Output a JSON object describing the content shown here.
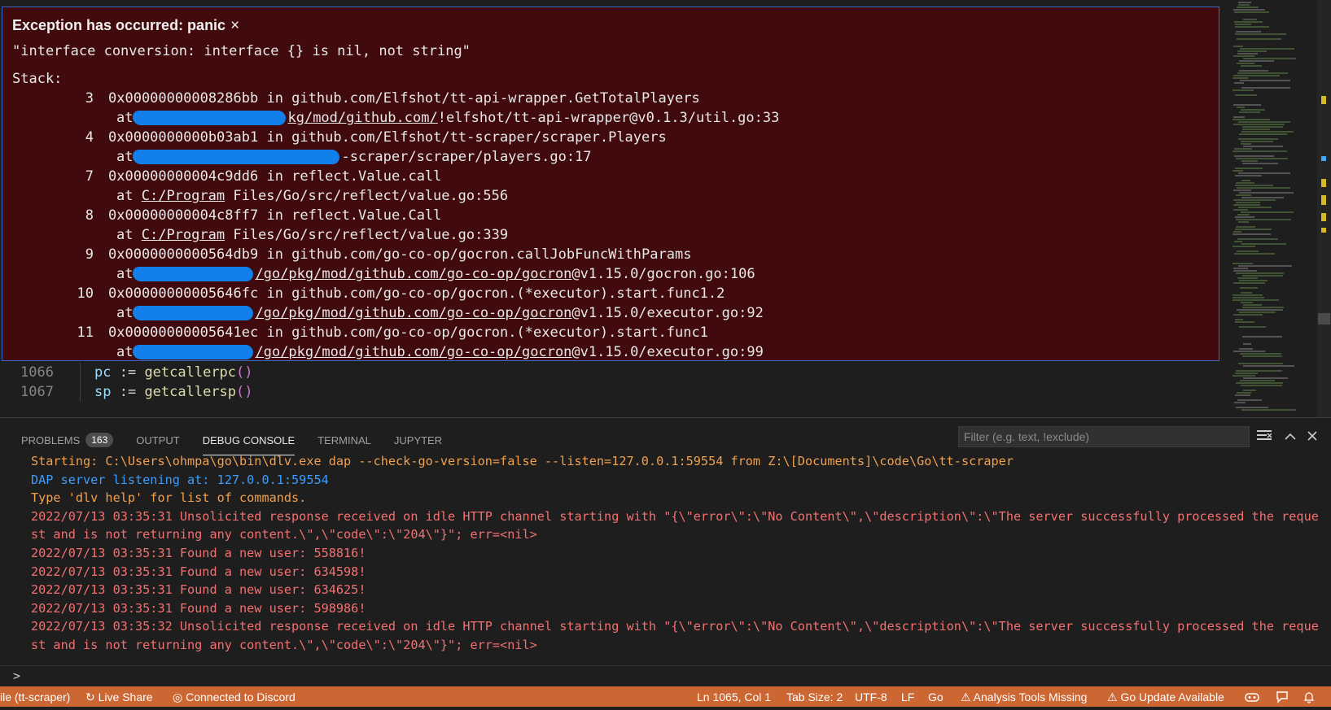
{
  "exception": {
    "title": "Exception has occurred: panic",
    "close_glyph": "×",
    "message": "\"interface conversion: interface {} is nil, not string\"",
    "stack_label": "Stack:",
    "frames": [
      {
        "num": "3",
        "addr": "0x00000000008286bb in github.com/Elfshot/tt-api-wrapper.GetTotalPlayers",
        "at": "at",
        "path_tail_link": "kg/mod/github.com/",
        "path_rest": "!elfshot/tt-api-wrapper@v0.1.3/util.go:33"
      },
      {
        "num": "4",
        "addr": "0x0000000000b03ab1 in github.com/Elfshot/tt-scraper/scraper.Players",
        "at": "at",
        "path_rest": "-scraper/scraper/players.go:17"
      },
      {
        "num": "7",
        "addr": "0x00000000004c9dd6 in reflect.Value.call",
        "at": "at",
        "path_link": "C:/Program",
        "path_rest": " Files/Go/src/reflect/value.go:556"
      },
      {
        "num": "8",
        "addr": "0x00000000004c8ff7 in reflect.Value.Call",
        "at": "at",
        "path_link": "C:/Program",
        "path_rest": " Files/Go/src/reflect/value.go:339"
      },
      {
        "num": "9",
        "addr": "0x0000000000564db9 in github.com/go-co-op/gocron.callJobFuncWithParams",
        "at": "at",
        "path_link": "/go/pkg/mod/github.com/go-co-op/gocron",
        "path_rest": "@v1.15.0/gocron.go:106"
      },
      {
        "num": "10",
        "addr": "0x00000000005646fc in github.com/go-co-op/gocron.(*executor).start.func1.2",
        "at": "at",
        "path_link": "/go/pkg/mod/github.com/go-co-op/gocron",
        "path_rest": "@v1.15.0/executor.go:92"
      },
      {
        "num": "11",
        "addr": "0x00000000005641ec in github.com/go-co-op/gocron.(*executor).start.func1",
        "at": "at",
        "path_link": "/go/pkg/mod/github.com/go-co-op/gocron",
        "path_rest": "@v1.15.0/executor.go:99"
      }
    ]
  },
  "code": {
    "lines": [
      {
        "num": "1066",
        "var": "pc",
        "op": " := ",
        "fn": "getcallerpc",
        "paren": "()"
      },
      {
        "num": "1067",
        "var": "sp",
        "op": " := ",
        "fn": "getcallersp",
        "paren": "()"
      }
    ]
  },
  "panel": {
    "tabs": [
      {
        "label": "PROBLEMS",
        "badge": "163"
      },
      {
        "label": "OUTPUT"
      },
      {
        "label": "DEBUG CONSOLE",
        "active": true
      },
      {
        "label": "TERMINAL"
      },
      {
        "label": "JUPYTER"
      }
    ],
    "filter_placeholder": "Filter (e.g. text, !exclude)",
    "console_lines": [
      {
        "color": "orange",
        "text": "Starting: C:\\Users\\ohmpa\\go\\bin\\dlv.exe dap --check-go-version=false --listen=127.0.0.1:59554 from Z:\\[Documents]\\code\\Go\\tt-scraper"
      },
      {
        "color": "blue",
        "text": "DAP server listening at: 127.0.0.1:59554"
      },
      {
        "color": "orange",
        "text": "Type 'dlv help' for list of commands."
      },
      {
        "color": "red",
        "text": "2022/07/13 03:35:31 Unsolicited response received on idle HTTP channel starting with \"{\\\"error\\\":\\\"No Content\\\",\\\"description\\\":\\\"The server successfully processed the request and is not returning any content.\\\",\\\"code\\\":\\\"204\\\"}\"; err=<nil>"
      },
      {
        "color": "red",
        "text": "2022/07/13 03:35:31 Found a new user: 558816!"
      },
      {
        "color": "red",
        "text": "2022/07/13 03:35:31 Found a new user: 634598!"
      },
      {
        "color": "red",
        "text": "2022/07/13 03:35:31 Found a new user: 634625!"
      },
      {
        "color": "red",
        "text": "2022/07/13 03:35:31 Found a new user: 598986!"
      },
      {
        "color": "red",
        "text": "2022/07/13 03:35:32 Unsolicited response received on idle HTTP channel starting with \"{\\\"error\\\":\\\"No Content\\\",\\\"description\\\":\\\"The server successfully processed the request and is not returning any content.\\\",\\\"code\\\":\\\"204\\\"}\"; err=<nil>"
      }
    ],
    "prompt": ">"
  },
  "statusbar": {
    "debug_target": "ile (tt-scraper)",
    "live_share": "Live Share",
    "discord": "Connected to Discord",
    "cursor": "Ln 1065, Col 1",
    "tab_size": "Tab Size: 2",
    "encoding": "UTF-8",
    "eol": "LF",
    "language": "Go",
    "analysis": "Analysis Tools Missing",
    "go_update": "Go Update Available"
  },
  "colors": {
    "exception_bg": "#410b0d",
    "statusbar_bg": "#cc6633",
    "redaction": "#1280ea"
  }
}
